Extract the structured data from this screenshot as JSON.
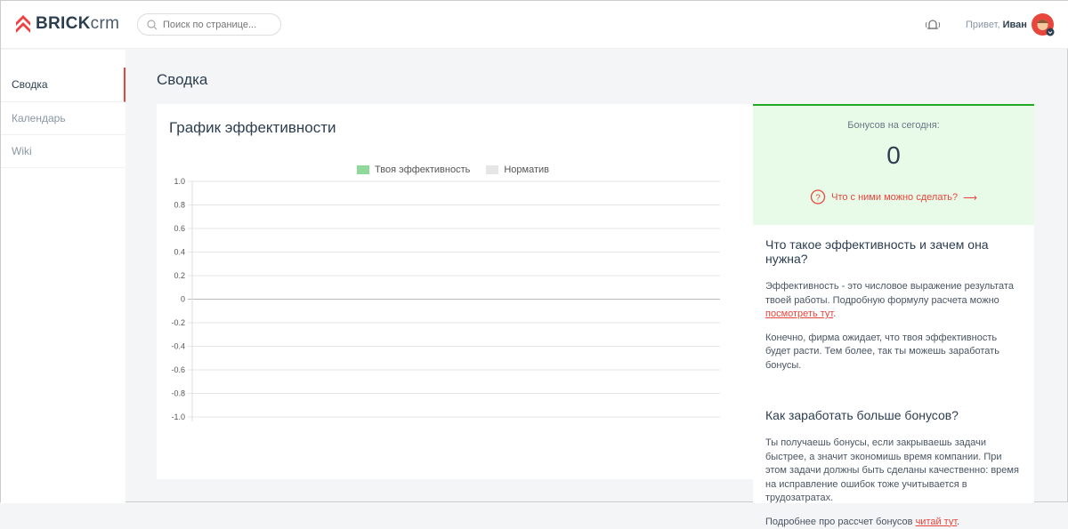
{
  "header": {
    "logo_bold": "BRICK",
    "logo_light": "crm",
    "search_placeholder": "Поиск по странице...",
    "greeting": "Привет,",
    "user_name": "Иван"
  },
  "sidebar": {
    "items": [
      {
        "label": "Сводка"
      },
      {
        "label": "Календарь"
      },
      {
        "label": "Wiki"
      }
    ]
  },
  "page_title": "Сводка",
  "chart_card": {
    "title": "График эффективности"
  },
  "chart_data": {
    "type": "line",
    "title": "",
    "xlabel": "",
    "ylabel": "",
    "ylim": [
      -1.0,
      1.0
    ],
    "y_ticks": [
      "1.0",
      "0.8",
      "0.6",
      "0.4",
      "0.2",
      "0",
      "-0.2",
      "-0.4",
      "-0.6",
      "-0.8",
      "-1.0"
    ],
    "series": [
      {
        "name": "Твоя эффективность",
        "color": "#8fd99a",
        "values": []
      },
      {
        "name": "Норматив",
        "color": "#e6e6e6",
        "values": []
      }
    ],
    "legend": "top",
    "grid": true
  },
  "bonus": {
    "label": "Бонусов на сегодня:",
    "value": "0",
    "link": "Что с ними можно сделать?"
  },
  "info": {
    "h1": "Что такое эффективность и зачем она нужна?",
    "p1": "Эффективность - это числовое выражение результата твоей работы. Подробную формулу расчета можно ",
    "p1_link": "посмотреть тут",
    "p1_end": ".",
    "p2": "Конечно, фирма ожидает, что твоя эффективность будет расти. Тем более, так ты можешь заработать бонусы.",
    "h2": "Как заработать больше бонусов?",
    "p3": "Ты получаешь бонусы, если закрываешь задачи быстрее, а значит экономишь время компании. При этом задачи должны быть сделаны качественно: время на исправление ошибок тоже учитывается в трудозатратах.",
    "p4": "Подробнее про рассчет бонусов ",
    "p4_link": "читай тут",
    "p4_end": "."
  }
}
